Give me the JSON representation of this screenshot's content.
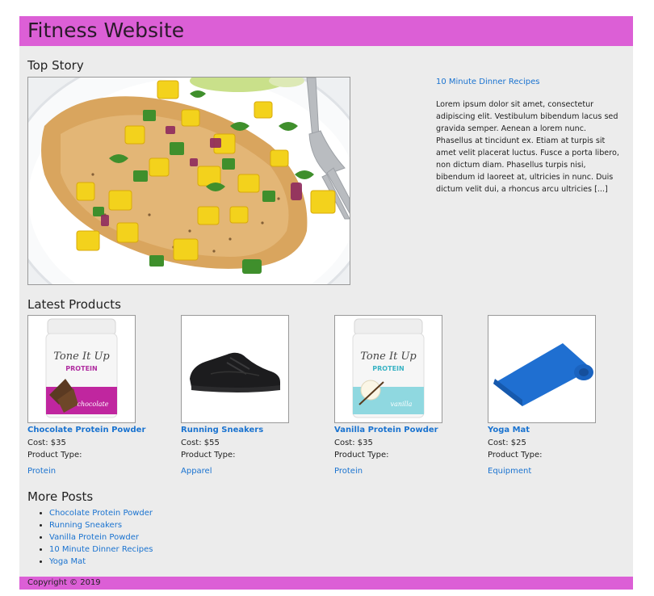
{
  "site": {
    "title": "Fitness Website"
  },
  "top_story": {
    "heading": "Top Story",
    "link": "10 Minute Dinner Recipes",
    "text": "Lorem ipsum dolor sit amet, consectetur adipiscing elit. Vestibulum bibendum lacus sed gravida semper. Aenean a lorem nunc. Phasellus at tincidunt ex. Etiam at turpis sit amet velit placerat luctus. Fusce a porta libero, non dictum diam. Phasellus turpis nisi, bibendum id laoreet at, ultricies in nunc. Duis dictum velit dui, a rhoncus arcu ultricies [...]"
  },
  "products": {
    "heading": "Latest Products",
    "items": [
      {
        "name": "Chocolate Protein Powder",
        "cost": "Cost: $35",
        "type_label": "Product Type:",
        "type": "Protein"
      },
      {
        "name": "Running Sneakers",
        "cost": "Cost: $55",
        "type_label": "Product Type:",
        "type": "Apparel"
      },
      {
        "name": "Vanilla Protein Powder",
        "cost": "Cost: $35",
        "type_label": "Product Type:",
        "type": "Protein"
      },
      {
        "name": "Yoga Mat",
        "cost": "Cost: $25",
        "type_label": "Product Type:",
        "type": "Equipment"
      }
    ],
    "tub_brand": "Tone It Up",
    "tub_label": "PROTEIN",
    "tub_flavors": [
      "chocolate",
      "vanilla"
    ]
  },
  "more_posts": {
    "heading": "More Posts",
    "items": [
      "Chocolate Protein Powder",
      "Running Sneakers",
      "Vanilla Protein Powder",
      "10 Minute Dinner Recipes",
      "Yoga Mat"
    ]
  },
  "footer": {
    "copyright": "Copyright © 2019"
  },
  "colors": {
    "header": "#dc5fd6",
    "background": "#ececec",
    "link": "#1a73d0"
  }
}
